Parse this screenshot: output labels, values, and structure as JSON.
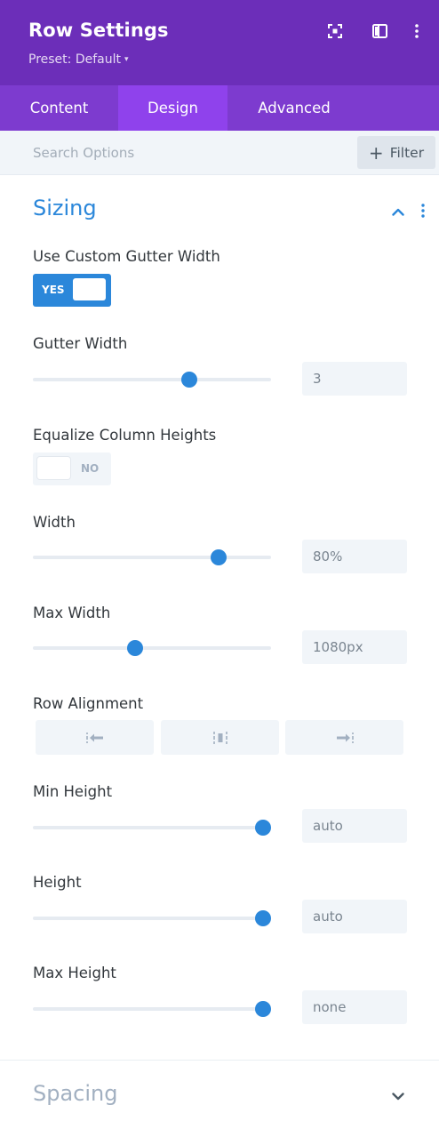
{
  "header": {
    "title": "Row Settings",
    "preset": "Preset: Default",
    "preset_caret": "▾",
    "icons": [
      "expand-icon",
      "sidebar-layout-icon",
      "more-vertical-icon"
    ],
    "background": "#6c2eb9"
  },
  "tabs": [
    {
      "label": "Content",
      "active": false
    },
    {
      "label": "Design",
      "active": true
    },
    {
      "label": "Advanced",
      "active": false
    }
  ],
  "search": {
    "placeholder": "Search Options",
    "value": "",
    "filter_icon": "+",
    "filter_label": "Filter"
  },
  "sections": {
    "sizing": {
      "title": "Sizing",
      "expanded": true
    },
    "spacing": {
      "title": "Spacing",
      "expanded": false
    }
  },
  "fields": {
    "custom_gutter": {
      "label": "Use Custom Gutter Width",
      "state": "YES",
      "on": true
    },
    "gutter_width": {
      "label": "Gutter Width",
      "value": "3",
      "slider_fraction": 0.655
    },
    "equalize_heights": {
      "label": "Equalize Column Heights",
      "state": "NO",
      "on": false
    },
    "width": {
      "label": "Width",
      "value": "80%",
      "slider_fraction": 0.78
    },
    "max_width": {
      "label": "Max Width",
      "value": "1080px",
      "slider_fraction": 0.43
    },
    "row_alignment": {
      "label": "Row Alignment",
      "options": [
        "align-left-icon",
        "align-center-icon",
        "align-right-icon"
      ]
    },
    "min_height": {
      "label": "Min Height",
      "value": "auto",
      "slider_fraction": 0.965
    },
    "height": {
      "label": "Height",
      "value": "auto",
      "slider_fraction": 0.965
    },
    "max_height": {
      "label": "Max Height",
      "value": "none",
      "slider_fraction": 0.965
    }
  },
  "colors": {
    "accent": "#2b87da",
    "header": "#6c2eb9",
    "tabs": "#7d3bcf",
    "active_tab": "#8f42ec"
  }
}
